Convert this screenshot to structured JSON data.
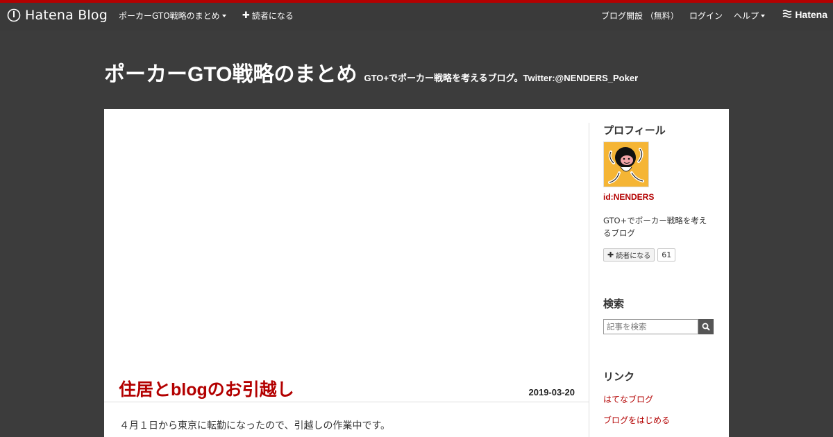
{
  "topbar": {
    "brand": "Hatena Blog",
    "blog_menu_label": "ポーカーGTO戦略のまとめ",
    "subscribe_label": "読者になる",
    "start_blog_label": "ブログ開設 （無料）",
    "login_label": "ログイン",
    "help_label": "ヘルプ",
    "hatena_label": "Hatena"
  },
  "header": {
    "title": "ポーカーGTO戦略のまとめ",
    "description": "GTO+でポーカー戦略を考えるブログ。Twitter:@NENDERS_Poker"
  },
  "entry": {
    "title": "住居とblogのお引越し",
    "date": "2019-03-20",
    "body_first_line": "４月１日から東京に転勤になったので、引越しの作業中です。"
  },
  "sidebar": {
    "profile": {
      "title": "プロフィール",
      "id": "id:NENDERS",
      "description": "GTO+でポーカー戦略を考えるブログ",
      "subscribe_label": "読者になる",
      "subscriber_count": "61"
    },
    "search": {
      "title": "検索",
      "placeholder": "記事を検索"
    },
    "links": {
      "title": "リンク",
      "items": [
        "はてなブログ",
        "ブログをはじめる"
      ]
    }
  },
  "colors": {
    "accent": "#b30000",
    "header_bg": "#3c3c3c",
    "avatar_bg": "#f5b535"
  }
}
